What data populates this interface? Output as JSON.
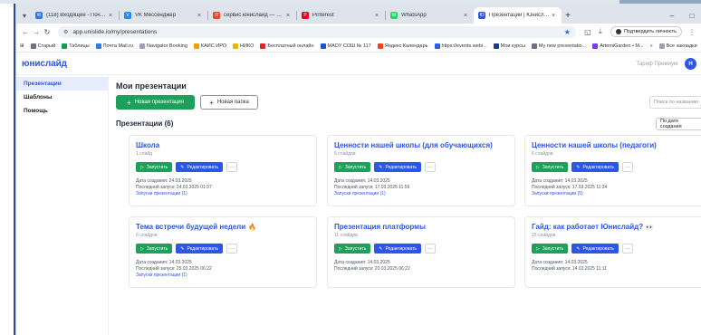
{
  "browser": {
    "tabs": [
      {
        "title": "(118) Входящие - Почта Mail",
        "color": "#2d7be6",
        "glyph": "✉"
      },
      {
        "title": "VK Мессенджер",
        "color": "#2787f5",
        "glyph": "V"
      },
      {
        "title": "сервис юнислайд — Яндекс",
        "color": "#fc3f1d",
        "glyph": "Я"
      },
      {
        "title": "Pinterest",
        "color": "#e60023",
        "glyph": "P"
      },
      {
        "title": "WhatsApp",
        "color": "#25d366",
        "glyph": "W"
      },
      {
        "title": "Презентации | Юнислайд",
        "color": "#2d55e6",
        "glyph": "Ю",
        "active": true
      }
    ],
    "new_tab": "+",
    "url": "app.unislide.io/my/presentations",
    "confirm_label": "Подтвердить личность",
    "bookmarks": [
      {
        "label": "Старый",
        "color": "#6b7280"
      },
      {
        "label": "Таблицы",
        "color": "#0f9d58"
      },
      {
        "label": "Почта Mail.ru",
        "color": "#2d7be6"
      },
      {
        "label": "Navigator Booking",
        "color": "#9ca3af"
      },
      {
        "label": "КАИС ИРО",
        "color": "#f59e0b"
      },
      {
        "label": "НИКО",
        "color": "#eab308"
      },
      {
        "label": "Бесплатный онлайн",
        "color": "#dc2626"
      },
      {
        "label": "МАОУ СОШ № 117",
        "color": "#1d4ed8"
      },
      {
        "label": "Яндекс Календарь",
        "color": "#fc3f1d"
      },
      {
        "label": "https://events.webi...",
        "color": "#2563eb"
      },
      {
        "label": "Мои курсы",
        "color": "#1e3a8a"
      },
      {
        "label": "My new presentatio...",
        "color": "#6b7280"
      },
      {
        "label": "ArtemiGarden • M...",
        "color": "#7c3aed"
      }
    ],
    "bookmarks_all": "Все закладки"
  },
  "header": {
    "logo": "юнислайд",
    "plan": "Тариф Премиум",
    "avatar_letter": "Н"
  },
  "sidebar": {
    "items": [
      {
        "label": "Презентации",
        "active": true
      },
      {
        "label": "Шаблоны",
        "active": false
      },
      {
        "label": "Помощь",
        "active": false
      }
    ]
  },
  "main": {
    "title": "Мои презентации",
    "new_presentation": "Новая презентация",
    "new_folder": "Новая папка",
    "search_placeholder": "Поиск по названию",
    "section_title": "Презентации (6)",
    "sort_label": "По дате создания"
  },
  "card_labels": {
    "launch": "Запустить",
    "edit": "Редактировать",
    "more": "···"
  },
  "cards": [
    {
      "title": "Школа",
      "emoji": "",
      "count": "1 слайд",
      "created": "Дата создания: 24.03.2025",
      "last_run": "Последний запуск: 24.03.2025 01:37",
      "runs": "Запуски презентации (1)"
    },
    {
      "title": "Ценности нашей школы (для обучающихся)",
      "emoji": "",
      "count": "6 слайдов",
      "created": "Дата создания: 14.03.2025",
      "last_run": "Последний запуск: 17.03.2025 11:56",
      "runs": "Запуски презентации (1)"
    },
    {
      "title": "Ценности нашей школы (педагоги)",
      "emoji": "",
      "count": "6 слайдов",
      "created": "Дата создания: 14.03.2025",
      "last_run": "Последний запуск: 17.03.2025 11:34",
      "runs": "Запуски презентации (5)"
    },
    {
      "title": "Тема встречи будущей недели",
      "emoji": "🔥",
      "count": "6 слайдов",
      "created": "Дата создания: 14.03.2025",
      "last_run": "Последний запуск: 25.03.2025 06:22",
      "runs": "Запуски презентации (1)"
    },
    {
      "title": "Презентация платформы",
      "emoji": "",
      "count": "11 слайдов",
      "created": "Дата создания: 14.03.2025",
      "last_run": "Последний запуск: 20.03.2025 06:22",
      "runs": ""
    },
    {
      "title": "Гайд: как работает Юнислайд?",
      "emoji": "👀",
      "count": "25 слайдов",
      "created": "Дата создания: 14.03.2025",
      "last_run": "Последний запуск: 14.03.2025 11:11",
      "runs": ""
    }
  ]
}
